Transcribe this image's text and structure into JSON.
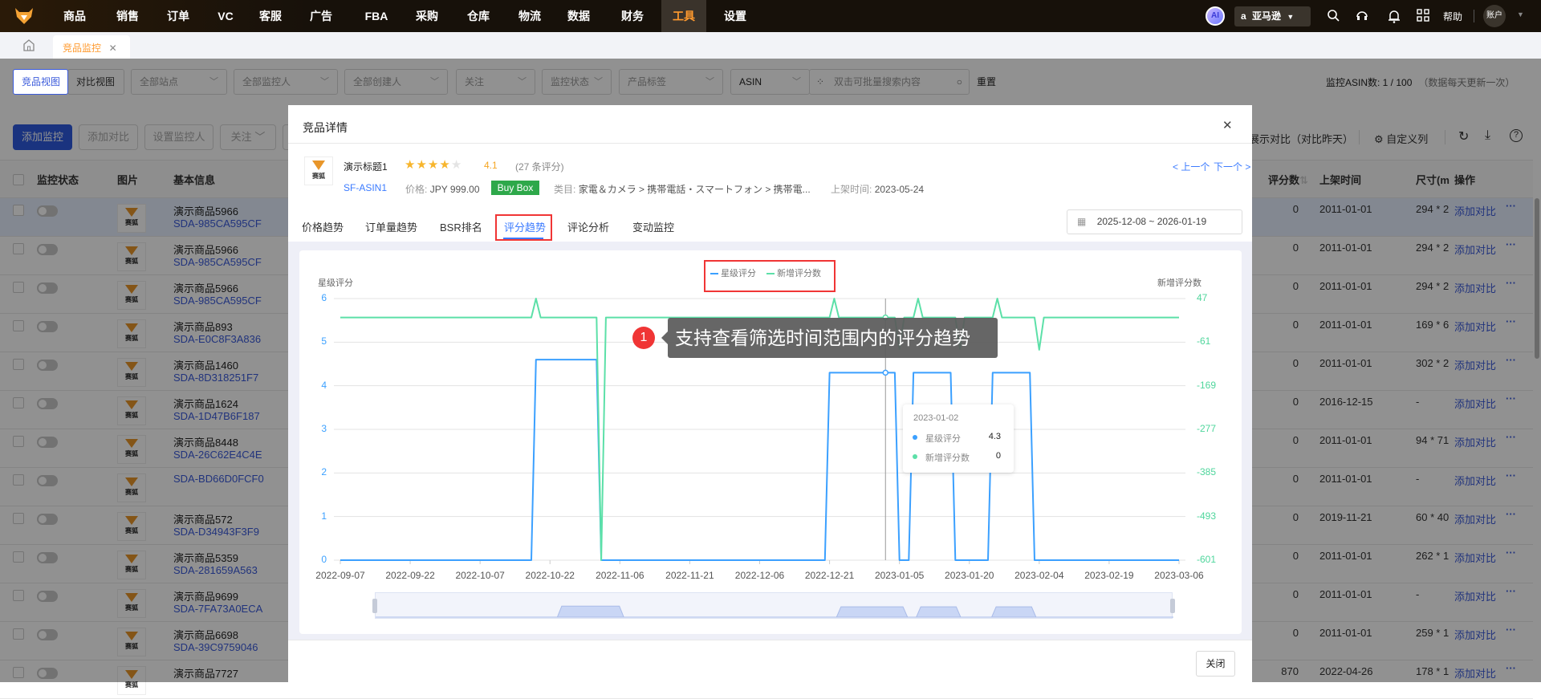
{
  "nav": {
    "items": [
      "商品",
      "销售",
      "订单",
      "VC",
      "客服",
      "广告",
      "FBA",
      "采购",
      "仓库",
      "物流",
      "数据",
      "财务",
      "工具",
      "设置"
    ],
    "active": "工具",
    "ai_label": "AI",
    "marketplace": "亚马逊",
    "help": "帮助",
    "account": "账户"
  },
  "tabs": {
    "current": "竞品监控"
  },
  "filters": {
    "view_active": "竞品视图",
    "view_other": "对比视图",
    "site": "全部站点",
    "monitor": "全部监控人",
    "creator": "全部创建人",
    "follow": "关注",
    "status": "监控状态",
    "tag": "产品标签",
    "search_type": "ASIN",
    "search_placeholder": "双击可批量搜索内容",
    "reset": "重置",
    "count_label": "监控ASIN数: 1 / 100",
    "count_note": "（数据每天更新一次）"
  },
  "actions": {
    "add_monitor": "添加监控",
    "add_compare": "添加对比",
    "set_monitor": "设置监控人",
    "follow": "关注",
    "show_compare": "展示对比（对比昨天）",
    "custom_cols": "自定义列"
  },
  "table": {
    "headers": {
      "status": "监控状态",
      "image": "图片",
      "info": "基本信息",
      "reviews": "评分数",
      "listed": "上架时间",
      "size": "尺寸(m",
      "ops": "操作"
    },
    "op_label": "添加对比",
    "more": "···",
    "image_logo": "赛狐",
    "rows": [
      {
        "name": "演示商品5966",
        "asin": "SDA-985CA595CF",
        "reviews": "0",
        "listed": "2011-01-01",
        "size": "294 * 2"
      },
      {
        "name": "演示商品5966",
        "asin": "SDA-985CA595CF",
        "reviews": "0",
        "listed": "2011-01-01",
        "size": "294 * 2"
      },
      {
        "name": "演示商品5966",
        "asin": "SDA-985CA595CF",
        "reviews": "0",
        "listed": "2011-01-01",
        "size": "294 * 2"
      },
      {
        "name": "演示商品893",
        "asin": "SDA-E0C8F3A836",
        "reviews": "0",
        "listed": "2011-01-01",
        "size": "169 * 6"
      },
      {
        "name": "演示商品1460",
        "asin": "SDA-8D318251F7",
        "reviews": "0",
        "listed": "2011-01-01",
        "size": "302 * 2"
      },
      {
        "name": "演示商品1624",
        "asin": "SDA-1D47B6F187",
        "reviews": "0",
        "listed": "2016-12-15",
        "size": "-"
      },
      {
        "name": "演示商品8448",
        "asin": "SDA-26C62E4C4E",
        "reviews": "0",
        "listed": "2011-01-01",
        "size": "94 * 71"
      },
      {
        "name": "",
        "asin": "SDA-BD66D0FCF0",
        "reviews": "0",
        "listed": "2011-01-01",
        "size": "-"
      },
      {
        "name": "演示商品572",
        "asin": "SDA-D34943F3F9",
        "reviews": "0",
        "listed": "2019-11-21",
        "size": "60 * 40"
      },
      {
        "name": "演示商品5359",
        "asin": "SDA-281659A563",
        "reviews": "0",
        "listed": "2011-01-01",
        "size": "262 * 1"
      },
      {
        "name": "演示商品9699",
        "asin": "SDA-7FA73A0ECA",
        "reviews": "0",
        "listed": "2011-01-01",
        "size": "-"
      },
      {
        "name": "演示商品6698",
        "asin": "SDA-39C9759046",
        "reviews": "0",
        "listed": "2011-01-01",
        "size": "259 * 1"
      },
      {
        "name": "演示商品7727",
        "asin": "",
        "reviews": "870",
        "listed": "2022-04-26",
        "size": "178 * 1"
      }
    ]
  },
  "modal": {
    "title": "竞品详情",
    "product": {
      "title": "演示标题1",
      "rating": 4.1,
      "rating_text": "4.1",
      "review_count": "(27 条评分)",
      "asin": "SF-ASIN1",
      "price_label": "价格:",
      "price": "JPY 999.00",
      "buybox": "Buy Box",
      "category_label": "类目:",
      "category": "家電＆カメラ > 携帯電話・スマートフォン > 携帯電...",
      "listed_label": "上架时间:",
      "listed": "2023-05-24",
      "logo": "赛狐"
    },
    "prev": "< 上一个",
    "next": "下一个 >",
    "tabs": [
      "价格趋势",
      "订单量趋势",
      "BSR排名",
      "评分趋势",
      "评论分析",
      "变动监控"
    ],
    "active_tab": "评分趋势",
    "date_range": "2025-12-08 ~ 2026-01-19",
    "close": "关闭",
    "guide": {
      "step": "1",
      "text": "支持查看筛选时间范围内的评分趋势"
    }
  },
  "chart_data": {
    "type": "line",
    "xlabel": "",
    "x_ticks": [
      "2022-09-07",
      "2022-09-22",
      "2022-10-07",
      "2022-10-22",
      "2022-11-06",
      "2022-11-21",
      "2022-12-06",
      "2022-12-21",
      "2023-01-05",
      "2023-01-20",
      "2023-02-04",
      "2023-02-19",
      "2023-03-06"
    ],
    "x_range": [
      "2022-09-07",
      "2023-03-06"
    ],
    "y_left": {
      "label": "星级评分",
      "range": [
        0,
        6
      ],
      "ticks": [
        "0",
        "1",
        "2",
        "3",
        "4",
        "5",
        "6"
      ]
    },
    "y_right": {
      "label": "新增评分数",
      "range": [
        -601,
        47
      ],
      "ticks": [
        "-601",
        "-493",
        "-385",
        "-277",
        "-169",
        "-61",
        "47"
      ]
    },
    "legend": [
      "星级评分",
      "新增评分数"
    ],
    "legend_position": "top-center",
    "grid": true,
    "colors": {
      "rating": "#3ba0ff",
      "new_reviews": "#5ce0a8"
    },
    "series": [
      {
        "name": "星级评分",
        "axis": "left",
        "points": [
          [
            "2022-09-07",
            0
          ],
          [
            "2022-10-18",
            0
          ],
          [
            "2022-10-19",
            4.6
          ],
          [
            "2022-11-01",
            4.6
          ],
          [
            "2022-11-02",
            0
          ],
          [
            "2022-12-20",
            0
          ],
          [
            "2022-12-21",
            4.3
          ],
          [
            "2023-01-04",
            4.3
          ],
          [
            "2023-01-05",
            0
          ],
          [
            "2023-01-07",
            0
          ],
          [
            "2023-01-08",
            4.3
          ],
          [
            "2023-01-16",
            4.3
          ],
          [
            "2023-01-17",
            0
          ],
          [
            "2023-01-24",
            0
          ],
          [
            "2023-01-25",
            4.3
          ],
          [
            "2023-02-02",
            4.3
          ],
          [
            "2023-02-03",
            0
          ],
          [
            "2023-03-06",
            0
          ]
        ]
      },
      {
        "name": "新增评分数",
        "axis": "right",
        "points": [
          [
            "2022-09-07",
            0
          ],
          [
            "2022-10-18",
            0
          ],
          [
            "2022-10-19",
            47
          ],
          [
            "2022-10-20",
            0
          ],
          [
            "2022-11-01",
            0
          ],
          [
            "2022-11-02",
            -601
          ],
          [
            "2022-11-03",
            0
          ],
          [
            "2022-12-21",
            0
          ],
          [
            "2022-12-22",
            47
          ],
          [
            "2022-12-23",
            0
          ],
          [
            "2023-01-04",
            0
          ],
          [
            "2023-01-05",
            -78
          ],
          [
            "2023-01-06",
            0
          ],
          [
            "2023-01-08",
            0
          ],
          [
            "2023-01-09",
            47
          ],
          [
            "2023-01-10",
            0
          ],
          [
            "2023-01-17",
            0
          ],
          [
            "2023-01-18",
            -78
          ],
          [
            "2023-01-19",
            0
          ],
          [
            "2023-01-25",
            0
          ],
          [
            "2023-01-26",
            47
          ],
          [
            "2023-01-27",
            0
          ],
          [
            "2023-02-03",
            0
          ],
          [
            "2023-02-04",
            -80
          ],
          [
            "2023-02-05",
            0
          ],
          [
            "2023-03-06",
            0
          ]
        ]
      }
    ],
    "tooltip": {
      "date": "2023-01-02",
      "rows": [
        {
          "name": "星级评分",
          "value": "4.3"
        },
        {
          "name": "新增评分数",
          "value": "0"
        }
      ]
    }
  }
}
